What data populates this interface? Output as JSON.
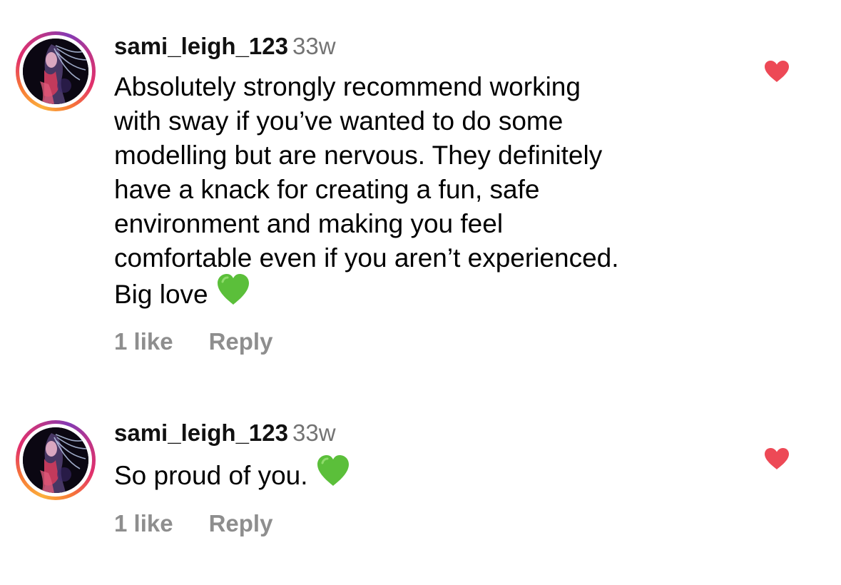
{
  "comments": [
    {
      "username": "sami_leigh_123",
      "time": "33w",
      "text": "Absolutely strongly recommend working\nwith sway if you’ve wanted to do some\nmodelling but are nervous. They definitely\nhave a knack for creating a fun, safe\nenvironment and making you feel\ncomfortable even if you aren’t experienced.\nBig love",
      "trailing_emoji": "green-heart",
      "likes": "1 like",
      "reply_label": "Reply",
      "liked": true
    },
    {
      "username": "sami_leigh_123",
      "time": "33w",
      "text": "So proud of you.",
      "trailing_emoji": "green-heart",
      "likes": "1 like",
      "reply_label": "Reply",
      "liked": true
    }
  ],
  "colors": {
    "like_heart": "#ed4956",
    "green_heart": "#5bbf3a",
    "secondary_text": "#8e8e8e",
    "timestamp_text": "#737373"
  }
}
